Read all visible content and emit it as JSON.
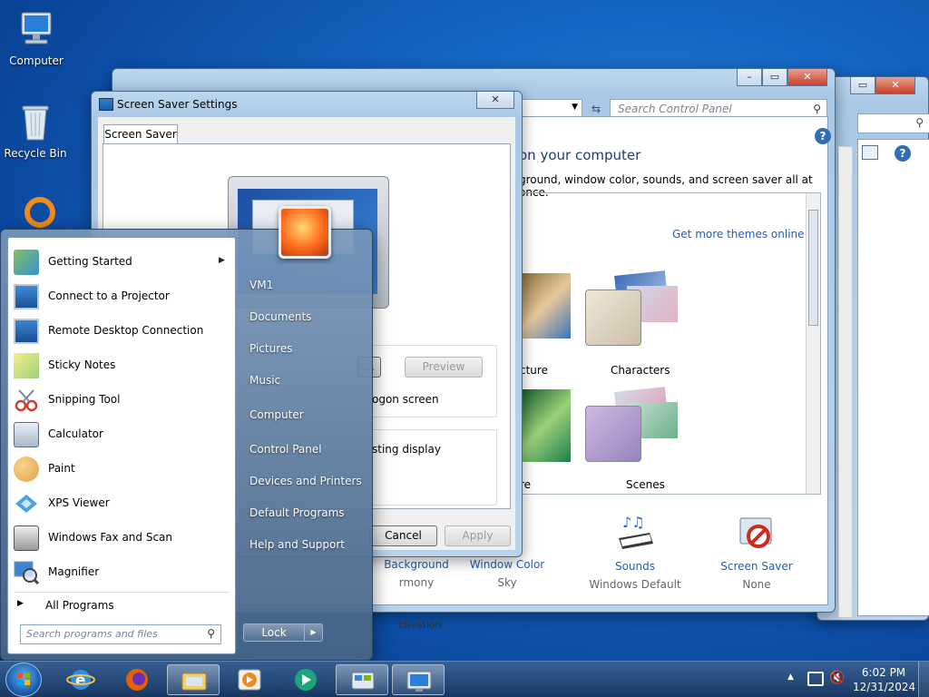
{
  "desktop": {
    "icons": [
      {
        "label": "Computer"
      },
      {
        "label": "Recycle Bin"
      }
    ]
  },
  "control_panel": {
    "search_placeholder": "Search Control Panel",
    "heading": "on your computer",
    "subtitle": "ground, window color, sounds, and screen saver all at once.",
    "get_more_themes": "Get more themes online",
    "themes": [
      {
        "label": "cture"
      },
      {
        "label": "Characters"
      },
      {
        "label": "re"
      },
      {
        "label": "Scenes"
      }
    ],
    "bottom_items": [
      {
        "label": "Background",
        "value": "rmony"
      },
      {
        "label": "Window Color",
        "value": "Sky"
      },
      {
        "label": "Sounds",
        "value": "Windows Default"
      },
      {
        "label": "Screen Saver",
        "value": "None"
      }
    ],
    "partial_text": "ctivation"
  },
  "screensaver_dialog": {
    "title": "Screen Saver Settings",
    "tab": "Screen Saver",
    "settings_button": "...",
    "preview_button": "Preview",
    "logon_text": "ogon screen",
    "display_text": "sting display",
    "cancel_button": "Cancel",
    "apply_button": "Apply"
  },
  "start_menu": {
    "left_items": [
      {
        "label": "Getting Started",
        "arrow": "▶"
      },
      {
        "label": "Connect to a Projector"
      },
      {
        "label": "Remote Desktop Connection"
      },
      {
        "label": "Sticky Notes"
      },
      {
        "label": "Snipping Tool"
      },
      {
        "label": "Calculator"
      },
      {
        "label": "Paint"
      },
      {
        "label": "XPS Viewer"
      },
      {
        "label": "Windows Fax and Scan"
      },
      {
        "label": "Magnifier"
      }
    ],
    "all_programs": "All Programs",
    "search_placeholder": "Search programs and files",
    "right_items": [
      {
        "label": "VM1"
      },
      {
        "label": "Documents"
      },
      {
        "label": "Pictures"
      },
      {
        "label": "Music"
      },
      {
        "label": "Computer"
      },
      {
        "label": "Control Panel"
      },
      {
        "label": "Devices and Printers"
      },
      {
        "label": "Default Programs"
      },
      {
        "label": "Help and Support"
      }
    ],
    "lock_button": "Lock"
  },
  "taskbar": {
    "time": "6:02 PM",
    "date": "12/31/2024"
  }
}
